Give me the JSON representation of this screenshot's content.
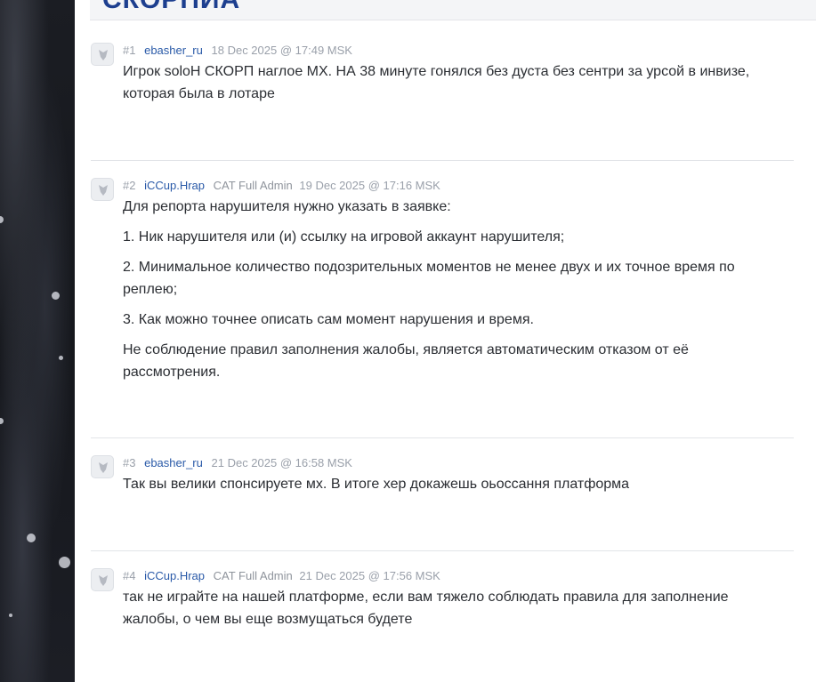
{
  "header": {
    "title": "СКОРПИА"
  },
  "posts": [
    {
      "num": "#1",
      "author": "ebasher_ru",
      "role": "",
      "date": "18 Dec 2025 @ 17:49 MSK",
      "paragraphs": [
        "Игрок soloH СКОРП наглое МХ. НА 38 минуте гонялся без дуста без сентри за урсой в инвизе, которая была в лотаре"
      ]
    },
    {
      "num": "#2",
      "author": "iCCup.Hrap",
      "role": "CAT Full Admin",
      "date": "19 Dec 2025 @ 17:16 MSK",
      "paragraphs": [
        "Для репорта нарушителя нужно указать в заявке:",
        "1. Ник нарушителя или (и) ссылку на игровой аккаунт нарушителя;",
        "2. Минимальное количество подозрительных моментов не менее двух и их точное время по реплею;",
        "3. Как можно точнее описать сам момент нарушения и время.",
        "Не соблюдение правил заполнения жалобы, является автоматическим отказом от её рассмотрения."
      ]
    },
    {
      "num": "#3",
      "author": "ebasher_ru",
      "role": "",
      "date": "21 Dec 2025 @ 16:58 MSK",
      "paragraphs": [
        "Так вы велики спонсируете мх. В итоге хер докажешь оьоссання платформа"
      ]
    },
    {
      "num": "#4",
      "author": "iCCup.Hrap",
      "role": "CAT Full Admin",
      "date": "21 Dec 2025 @ 17:56 MSK",
      "paragraphs": [
        "так не играйте на нашей платформе, если вам тяжело соблюдать правила для заполнение жалобы, о чем вы еще возмущаться будете"
      ]
    }
  ]
}
